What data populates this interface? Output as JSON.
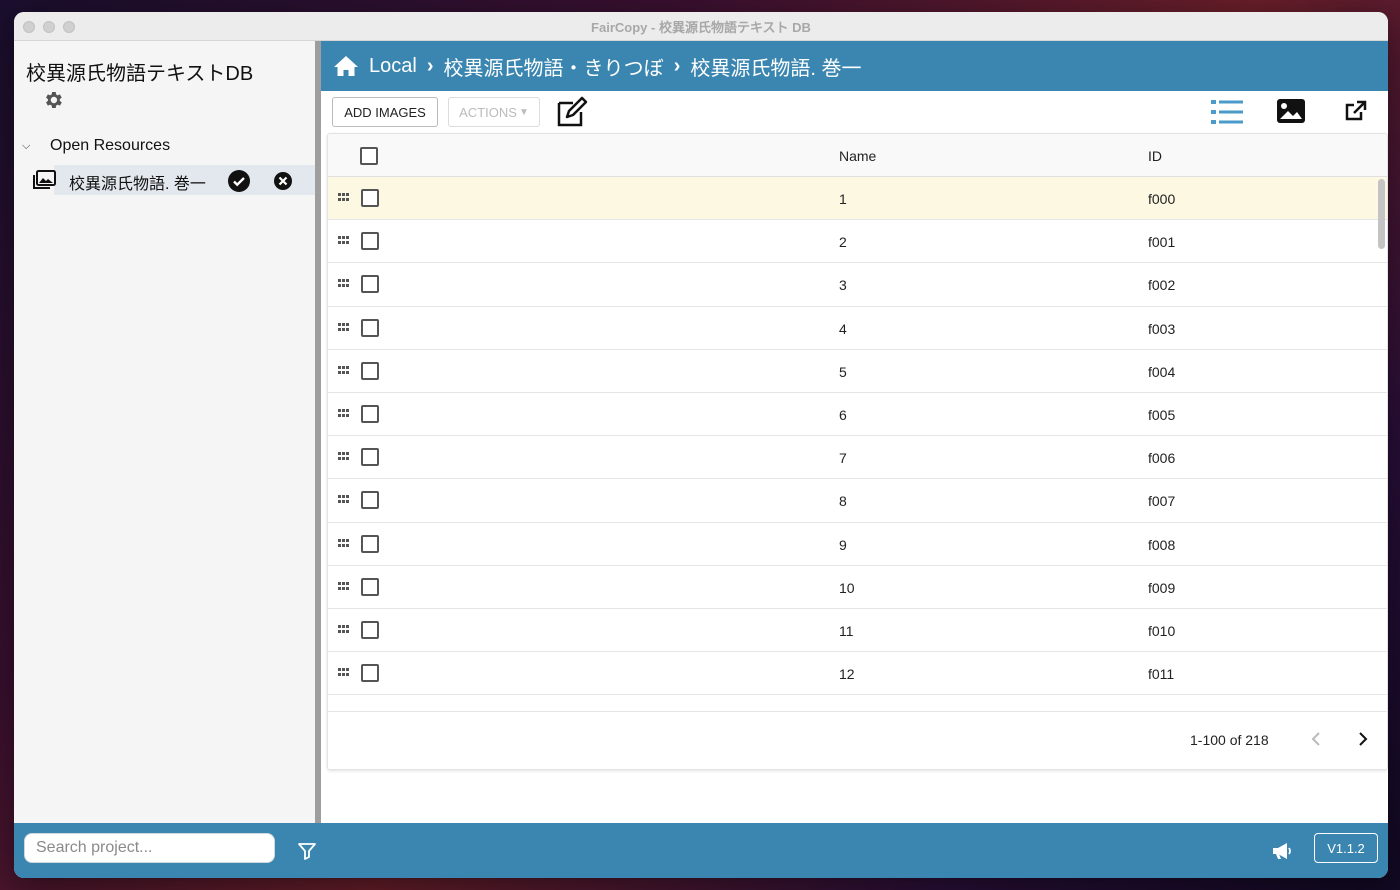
{
  "window": {
    "title": "FairCopy - 校異源氏物語テキスト DB"
  },
  "sidebar": {
    "project_title": "校異源氏物語テキストDB",
    "tree_header": "Open Resources",
    "resource_label": "校異源氏物語. 巻一"
  },
  "breadcrumb": [
    "Local",
    "校異源氏物語・きりつぼ",
    "校異源氏物語. 巻一"
  ],
  "toolbar": {
    "add_images": "ADD IMAGES",
    "actions": "ACTIONS"
  },
  "table": {
    "header_name": "Name",
    "header_id": "ID",
    "rows": [
      {
        "name": "1",
        "id": "f000"
      },
      {
        "name": "2",
        "id": "f001"
      },
      {
        "name": "3",
        "id": "f002"
      },
      {
        "name": "4",
        "id": "f003"
      },
      {
        "name": "5",
        "id": "f004"
      },
      {
        "name": "6",
        "id": "f005"
      },
      {
        "name": "7",
        "id": "f006"
      },
      {
        "name": "8",
        "id": "f007"
      },
      {
        "name": "9",
        "id": "f008"
      },
      {
        "name": "10",
        "id": "f009"
      },
      {
        "name": "11",
        "id": "f010"
      },
      {
        "name": "12",
        "id": "f011"
      }
    ]
  },
  "pager": {
    "range": "1-100 of 218"
  },
  "footer": {
    "search_placeholder": "Search project...",
    "version": "V1.1.2"
  },
  "colors": {
    "accent": "#3a86b0",
    "highlight_row": "#fdf8e1",
    "sidebar_bg": "#f5f5f5"
  }
}
